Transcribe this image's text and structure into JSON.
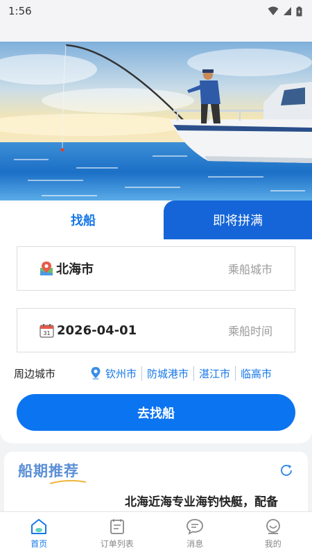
{
  "status_bar": {
    "time": "1:56"
  },
  "tabs": {
    "find_boat": "找船",
    "almost_full": "即将拼满"
  },
  "city_field": {
    "value": "北海市",
    "placeholder": "乘船城市",
    "icon": "map-pin-icon"
  },
  "date_field": {
    "value": "2026-04-01",
    "placeholder": "乘船时间",
    "icon": "calendar-icon",
    "calendar_day": "31"
  },
  "nearby": {
    "label": "周边城市",
    "cities": [
      "钦州市",
      "防城港市",
      "湛江市",
      "临高市"
    ]
  },
  "search_button": "去找船",
  "recommend": {
    "title": "船期推荐",
    "item_text": "北海近海专业海钓快艇，配备"
  },
  "bottom_nav": [
    {
      "label": "首页",
      "icon": "home-icon",
      "active": true
    },
    {
      "label": "订单列表",
      "icon": "order-list-icon",
      "active": false
    },
    {
      "label": "消息",
      "icon": "message-icon",
      "active": false
    },
    {
      "label": "我的",
      "icon": "profile-icon",
      "active": false
    }
  ],
  "colors": {
    "primary": "#0b74f0",
    "tab_active_bg": "#1565d8",
    "link": "#1677e8"
  }
}
